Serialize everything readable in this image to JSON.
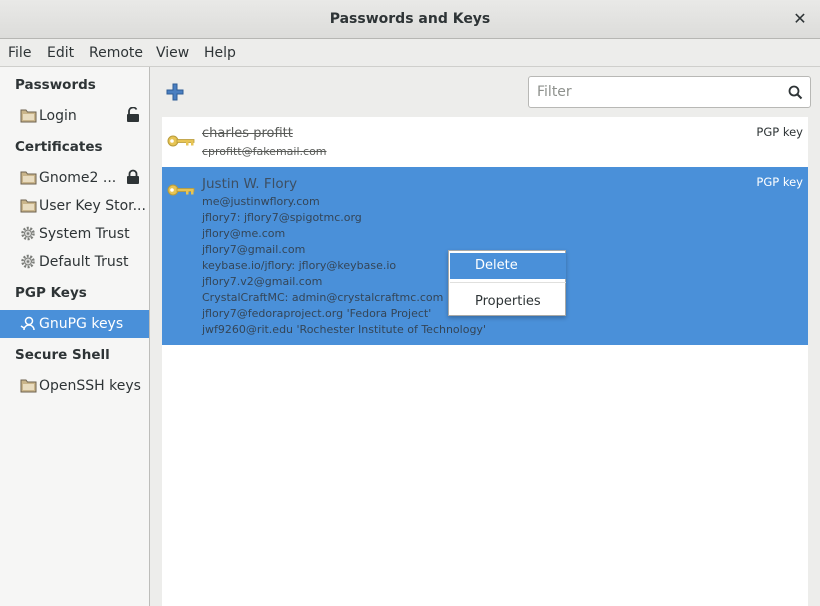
{
  "window": {
    "title": "Passwords and Keys",
    "close_glyph": "✕"
  },
  "menubar": {
    "items": [
      "File",
      "Edit",
      "Remote",
      "View",
      "Help"
    ]
  },
  "sidebar": {
    "sections": [
      {
        "header": "Passwords",
        "items": [
          {
            "label": "Login",
            "icon": "folder-icon",
            "locked": "unlocked"
          }
        ]
      },
      {
        "header": "Certificates",
        "items": [
          {
            "label": "Gnome2 ...",
            "icon": "folder-icon",
            "locked": "locked"
          },
          {
            "label": "User Key Stor...",
            "icon": "folder-icon"
          },
          {
            "label": "System Trust",
            "icon": "gear-icon"
          },
          {
            "label": "Default Trust",
            "icon": "gear-icon"
          }
        ]
      },
      {
        "header": "PGP Keys",
        "items": [
          {
            "label": "GnuPG keys",
            "icon": "person-icon",
            "selected": true
          }
        ]
      },
      {
        "header": "Secure Shell",
        "items": [
          {
            "label": "OpenSSH keys",
            "icon": "folder-icon"
          }
        ]
      }
    ]
  },
  "toolbar": {
    "add_icon": "plus-icon",
    "filter_placeholder": "Filter",
    "search_icon": "search-icon"
  },
  "keys": [
    {
      "name": "charles profitt",
      "type": "PGP key",
      "revoked": true,
      "uids": [
        "cprofitt@fakemail.com"
      ]
    },
    {
      "name": "Justin W. Flory",
      "type": "PGP key",
      "selected": true,
      "uids": [
        "me@justinwflory.com",
        "jflory7: jflory7@spigotmc.org",
        "jflory@me.com",
        "jflory7@gmail.com",
        "keybase.io/jflory: jflory@keybase.io",
        "jflory7.v2@gmail.com",
        "CrystalCraftMC: admin@crystalcraftmc.com",
        "jflory7@fedoraproject.org 'Fedora Project'",
        "jwf9260@rit.edu 'Rochester Institute of Technology'"
      ]
    }
  ],
  "context_menu": {
    "items": [
      "Delete",
      "Properties"
    ],
    "highlighted": "Delete"
  },
  "colors": {
    "selection": "#4a90d9",
    "key_gold": "#e7c454"
  }
}
